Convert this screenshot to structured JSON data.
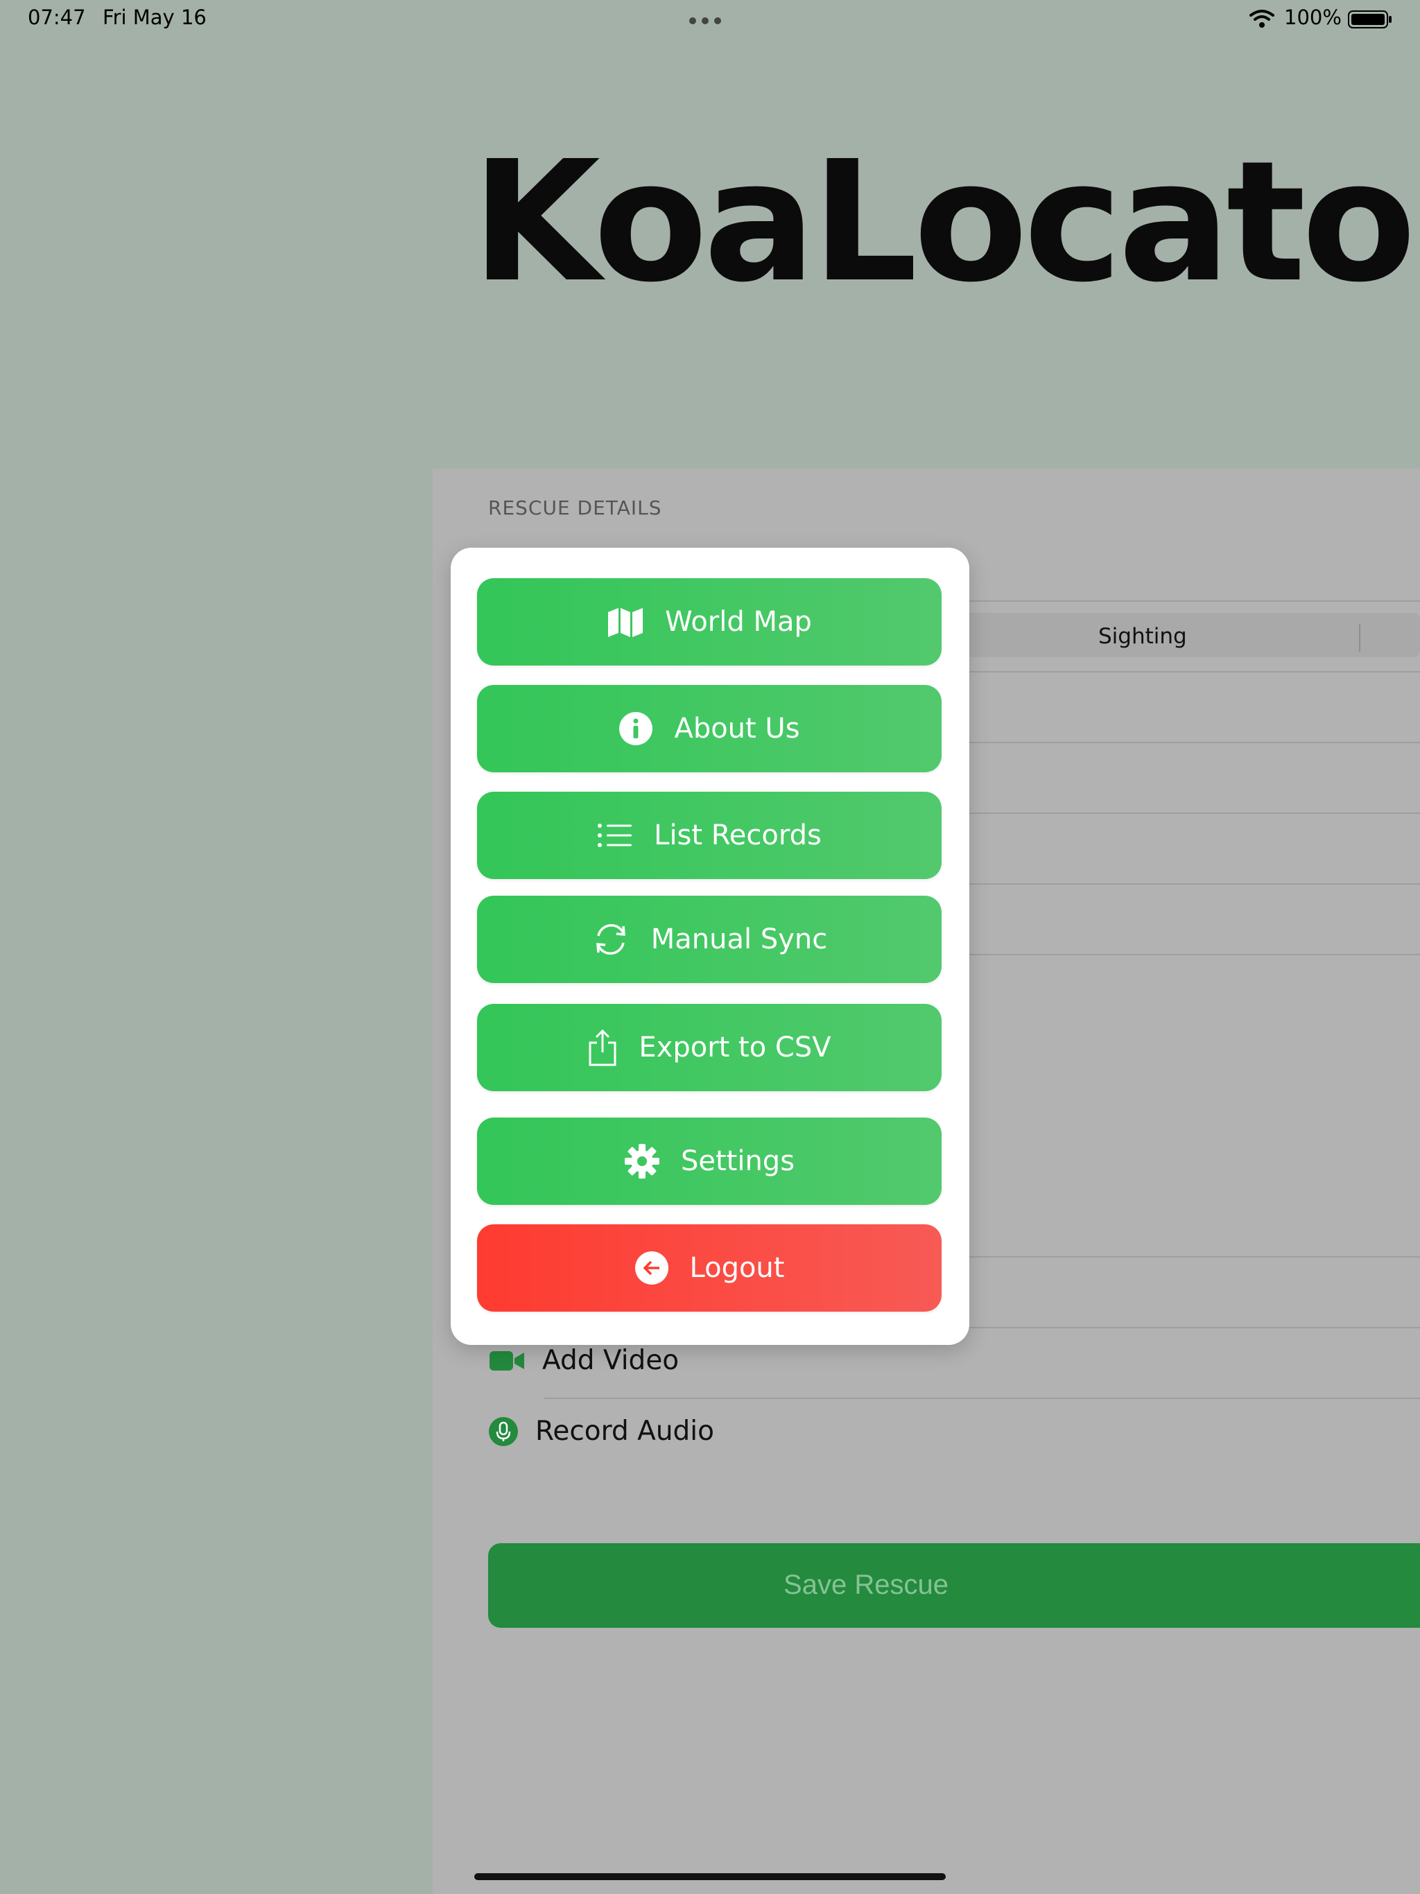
{
  "status_bar": {
    "time": "07:47",
    "date": "Fri May 16",
    "battery": "100%"
  },
  "app": {
    "title": "KoaLocator"
  },
  "form": {
    "section_header": "RESCUE DETAILS",
    "segment_visible": "Sighting",
    "add_video": "Add Video",
    "record_audio": "Record Audio",
    "save_button": "Save Rescue"
  },
  "menu": {
    "items": [
      {
        "label": "World Map",
        "icon": "map-icon"
      },
      {
        "label": "About Us",
        "icon": "info-icon"
      },
      {
        "label": "List Records",
        "icon": "list-icon"
      },
      {
        "label": "Manual Sync",
        "icon": "sync-icon"
      },
      {
        "label": "Export to CSV",
        "icon": "share-icon"
      },
      {
        "label": "Settings",
        "icon": "gear-icon"
      },
      {
        "label": "Logout",
        "icon": "logout-icon"
      }
    ]
  },
  "colors": {
    "background": "#a4b1a8",
    "menu_green": "#34c759",
    "logout_red": "#ff3b30",
    "save_green": "#238a3e"
  }
}
